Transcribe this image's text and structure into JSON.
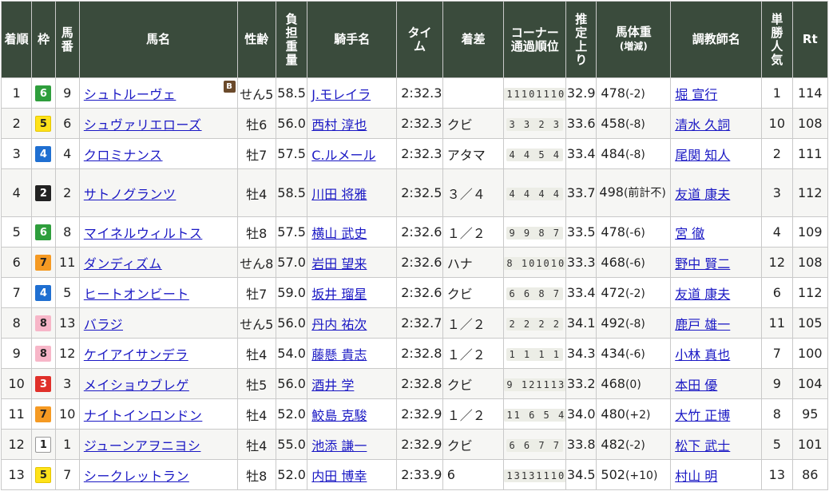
{
  "headers": {
    "rank": "着順",
    "frame": "枠",
    "num": "馬番",
    "horse": "馬名",
    "sexage": "性齢",
    "weight": "負担重量",
    "jockey": "騎手名",
    "time": "タイム",
    "margin": "着差",
    "corner": "コーナー通過順位",
    "last": "推定上り",
    "bw": "馬体重",
    "bw_sub": "(増減)",
    "trainer": "調教師名",
    "pop": "単勝人気",
    "rt": "Rt"
  },
  "frame_colors": {
    "1": {
      "bg": "#ffffff",
      "fg": "#222222",
      "border": "#999999"
    },
    "2": {
      "bg": "#222222",
      "fg": "#ffffff",
      "border": "#222222"
    },
    "3": {
      "bg": "#e0302a",
      "fg": "#ffffff",
      "border": "#e0302a"
    },
    "4": {
      "bg": "#1f6fd1",
      "fg": "#ffffff",
      "border": "#1f6fd1"
    },
    "5": {
      "bg": "#ffe21a",
      "fg": "#222222",
      "border": "#e5c600"
    },
    "6": {
      "bg": "#2e9e3c",
      "fg": "#ffffff",
      "border": "#2e9e3c"
    },
    "7": {
      "bg": "#f59a23",
      "fg": "#222222",
      "border": "#f59a23"
    },
    "8": {
      "bg": "#f7b6c8",
      "fg": "#222222",
      "border": "#f7b6c8"
    }
  },
  "rows": [
    {
      "rank": "1",
      "frame": "6",
      "num": "9",
      "horse": "シュトルーヴェ",
      "blinker": "B",
      "sexage": "せん5",
      "weight": "58.5",
      "jockey": "J.モレイラ",
      "time": "2:32.3",
      "margin": "",
      "corner": "11101110",
      "last": "32.9",
      "bw": "478",
      "bw_diff": "(-2)",
      "trainer": "堀 宣行",
      "pop": "1",
      "rt": "114"
    },
    {
      "rank": "2",
      "frame": "5",
      "num": "6",
      "horse": "シュヴァリエローズ",
      "blinker": "",
      "sexage": "牡6",
      "weight": "56.0",
      "jockey": "西村 淳也",
      "time": "2:32.3",
      "margin": "クビ",
      "corner": "3 3 2 3",
      "last": "33.6",
      "bw": "458",
      "bw_diff": "(-8)",
      "trainer": "清水 久詞",
      "pop": "10",
      "rt": "108"
    },
    {
      "rank": "3",
      "frame": "4",
      "num": "4",
      "horse": "クロミナンス",
      "blinker": "",
      "sexage": "牡7",
      "weight": "57.5",
      "jockey": "C.ルメール",
      "time": "2:32.3",
      "margin": "アタマ",
      "corner": "4 4 5 4",
      "last": "33.4",
      "bw": "484",
      "bw_diff": "(-8)",
      "trainer": "尾関 知人",
      "pop": "2",
      "rt": "111"
    },
    {
      "rank": "4",
      "frame": "2",
      "num": "2",
      "horse": "サトノグランツ",
      "blinker": "",
      "sexage": "牡4",
      "weight": "58.5",
      "jockey": "川田 将雅",
      "time": "2:32.5",
      "margin": "３／４",
      "corner": "4 4 4 4",
      "last": "33.7",
      "bw": "498",
      "bw_diff": "(前計不)",
      "trainer": "友道 康夫",
      "pop": "3",
      "rt": "112",
      "tall": true
    },
    {
      "rank": "5",
      "frame": "6",
      "num": "8",
      "horse": "マイネルウィルトス",
      "blinker": "",
      "sexage": "牡8",
      "weight": "57.5",
      "jockey": "横山 武史",
      "time": "2:32.6",
      "margin": "１／２",
      "corner": "9 9 8 7",
      "last": "33.5",
      "bw": "478",
      "bw_diff": "(-6)",
      "trainer": "宮 徹",
      "pop": "4",
      "rt": "109"
    },
    {
      "rank": "6",
      "frame": "7",
      "num": "11",
      "horse": "ダンディズム",
      "blinker": "",
      "sexage": "せん8",
      "weight": "57.0",
      "jockey": "岩田 望来",
      "time": "2:32.6",
      "margin": "ハナ",
      "corner": "8 101010",
      "last": "33.3",
      "bw": "468",
      "bw_diff": "(-6)",
      "trainer": "野中 賢二",
      "pop": "12",
      "rt": "108"
    },
    {
      "rank": "7",
      "frame": "4",
      "num": "5",
      "horse": "ヒートオンビート",
      "blinker": "",
      "sexage": "牡7",
      "weight": "59.0",
      "jockey": "坂井 瑠星",
      "time": "2:32.6",
      "margin": "クビ",
      "corner": "6 6 8 7",
      "last": "33.4",
      "bw": "472",
      "bw_diff": "(-2)",
      "trainer": "友道 康夫",
      "pop": "6",
      "rt": "112"
    },
    {
      "rank": "8",
      "frame": "8",
      "num": "13",
      "horse": "バラジ",
      "blinker": "",
      "sexage": "せん5",
      "weight": "56.0",
      "jockey": "丹内 祐次",
      "time": "2:32.7",
      "margin": "１／２",
      "corner": "2 2 2 2",
      "last": "34.1",
      "bw": "492",
      "bw_diff": "(-8)",
      "trainer": "鹿戸 雄一",
      "pop": "11",
      "rt": "105"
    },
    {
      "rank": "9",
      "frame": "8",
      "num": "12",
      "horse": "ケイアイサンデラ",
      "blinker": "",
      "sexage": "牡4",
      "weight": "54.0",
      "jockey": "藤懸 貴志",
      "time": "2:32.8",
      "margin": "１／２",
      "corner": "1 1 1 1",
      "last": "34.3",
      "bw": "434",
      "bw_diff": "(-6)",
      "trainer": "小林 真也",
      "pop": "7",
      "rt": "100"
    },
    {
      "rank": "10",
      "frame": "3",
      "num": "3",
      "horse": "メイショウブレゲ",
      "blinker": "",
      "sexage": "牡5",
      "weight": "56.0",
      "jockey": "酒井 学",
      "time": "2:32.8",
      "margin": "クビ",
      "corner": "9 121113",
      "last": "33.2",
      "bw": "468",
      "bw_diff": "(0)",
      "trainer": "本田 優",
      "pop": "9",
      "rt": "104"
    },
    {
      "rank": "11",
      "frame": "7",
      "num": "10",
      "horse": "ナイトインロンドン",
      "blinker": "",
      "sexage": "牡4",
      "weight": "52.0",
      "jockey": "鮫島 克駿",
      "time": "2:32.9",
      "margin": "１／２",
      "corner": "11 6 5 4",
      "last": "34.0",
      "bw": "480",
      "bw_diff": "(+2)",
      "trainer": "大竹 正博",
      "pop": "8",
      "rt": "95"
    },
    {
      "rank": "12",
      "frame": "1",
      "num": "1",
      "horse": "ジューンアヲニヨシ",
      "blinker": "",
      "sexage": "牡4",
      "weight": "55.0",
      "jockey": "池添 謙一",
      "time": "2:32.9",
      "margin": "クビ",
      "corner": "6 6 7 7",
      "last": "33.8",
      "bw": "482",
      "bw_diff": "(-2)",
      "trainer": "松下 武士",
      "pop": "5",
      "rt": "101"
    },
    {
      "rank": "13",
      "frame": "5",
      "num": "7",
      "horse": "シークレットラン",
      "blinker": "",
      "sexage": "牡8",
      "weight": "52.0",
      "jockey": "内田 博幸",
      "time": "2:33.9",
      "margin": "6",
      "corner": "13131110",
      "last": "34.5",
      "bw": "502",
      "bw_diff": "(+10)",
      "trainer": "村山 明",
      "pop": "13",
      "rt": "86"
    }
  ]
}
